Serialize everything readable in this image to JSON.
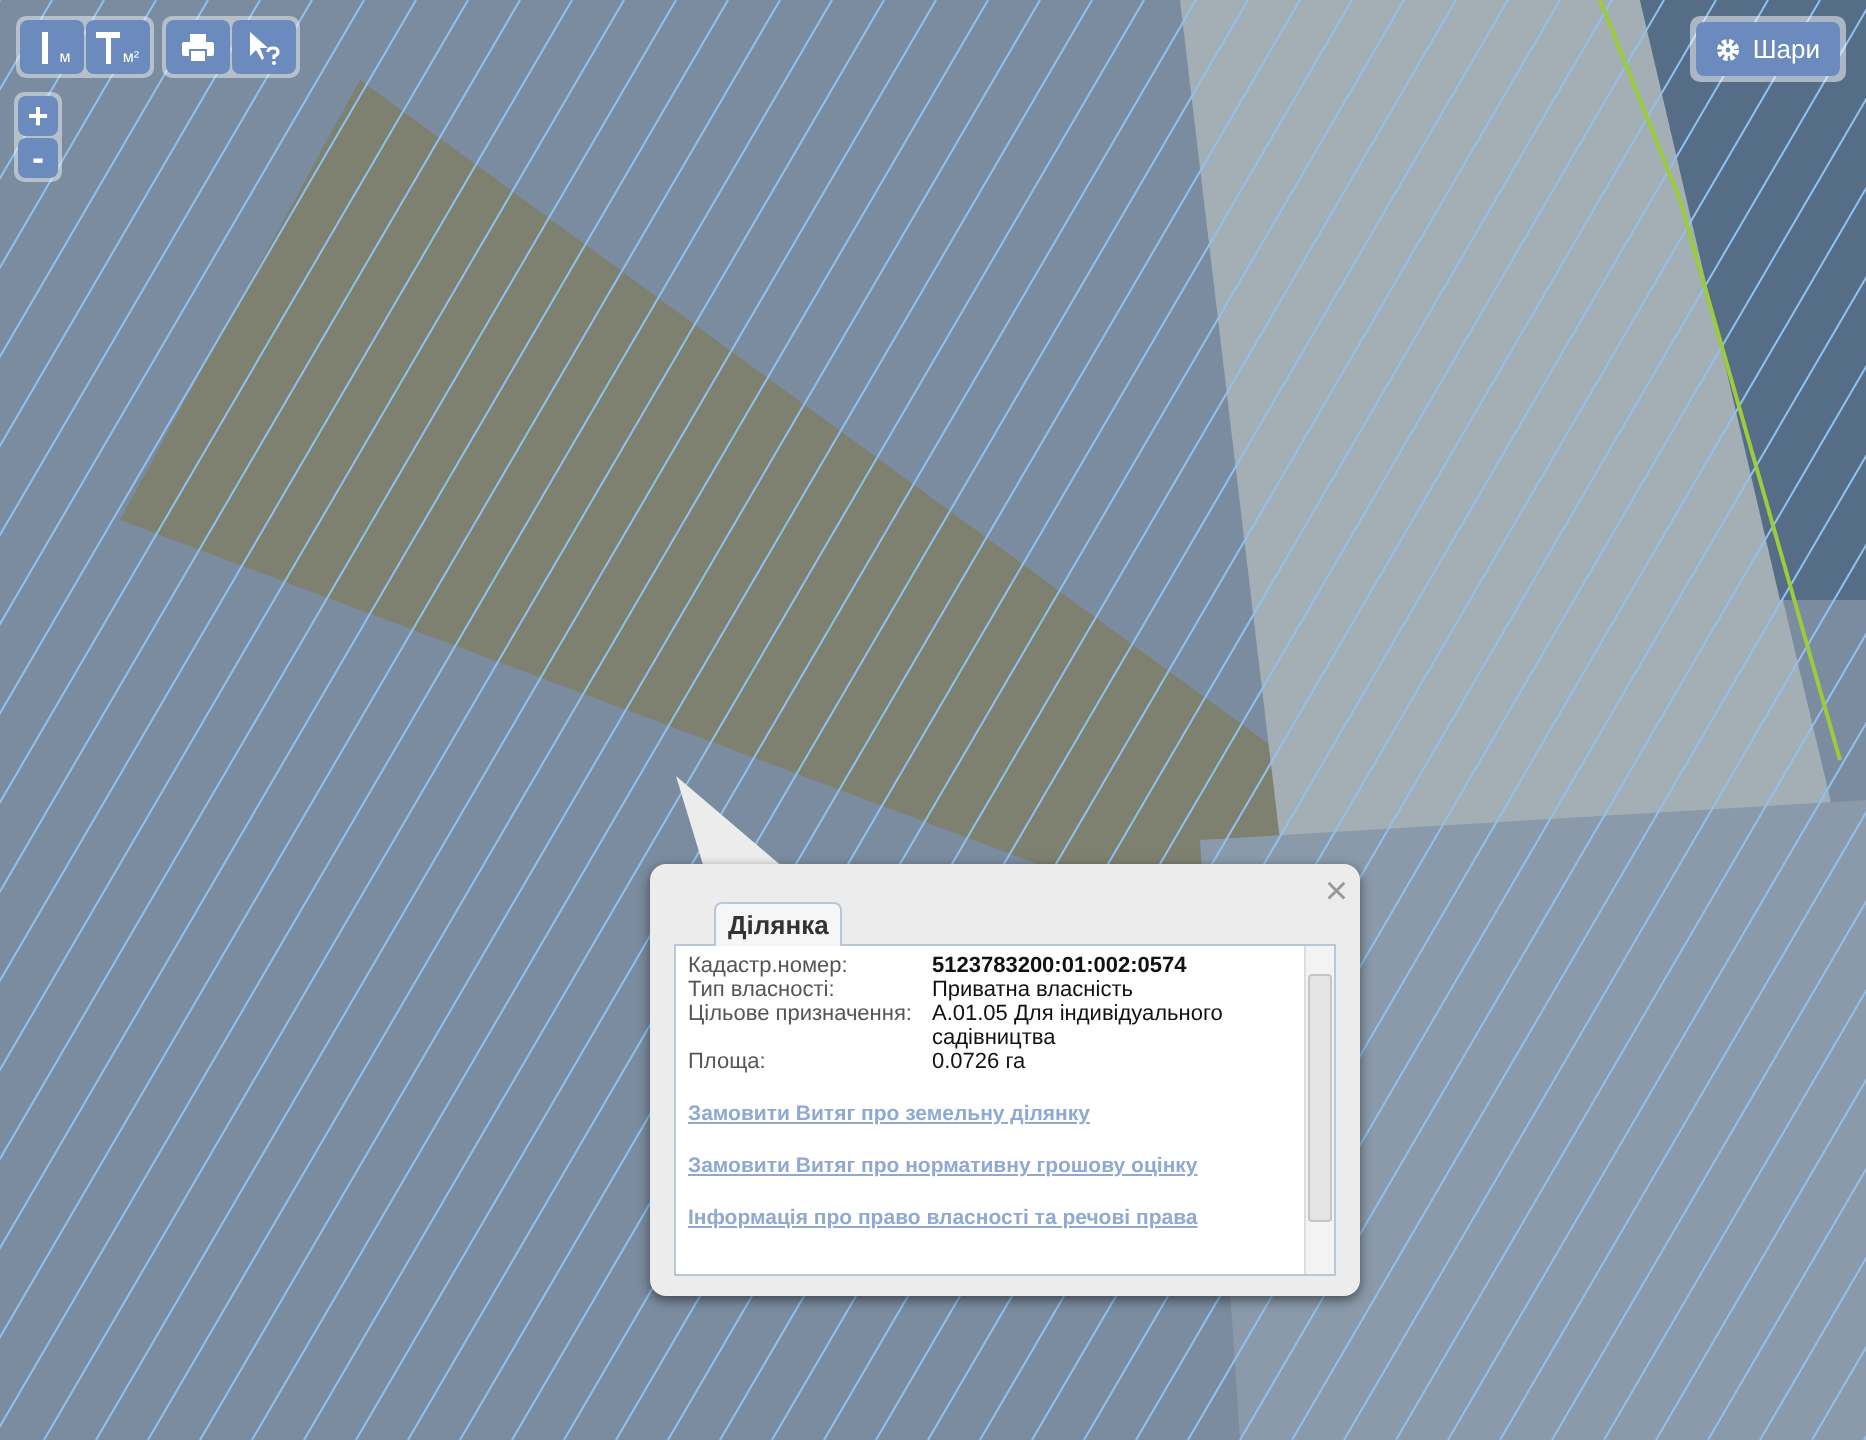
{
  "toolbar": {
    "measure_buttons": [
      {
        "label": "м"
      },
      {
        "label": "м²"
      }
    ]
  },
  "zoom": {
    "in": "+",
    "out": "-"
  },
  "layers_button": {
    "label": "Шари"
  },
  "popup": {
    "close": "×",
    "tabs": [
      {
        "label": "Ділянка",
        "selected": true
      }
    ],
    "fields": [
      {
        "label": "Кадастр.номер:",
        "value": "5123783200:01:002:0574",
        "bold": true
      },
      {
        "label": "Тип власності:",
        "value": "Приватна власність",
        "bold": false
      },
      {
        "label": "Цільове призначення:",
        "value": "А.01.05 Для індивідуального садівництва",
        "bold": false
      },
      {
        "label": "Площа:",
        "value": "0.0726 га",
        "bold": false
      }
    ],
    "links": [
      "Замовити Витяг про земельну ділянку",
      "Замовити Витяг про нормативну грошову оцінку",
      "Інформація про право власності та речові права"
    ]
  }
}
